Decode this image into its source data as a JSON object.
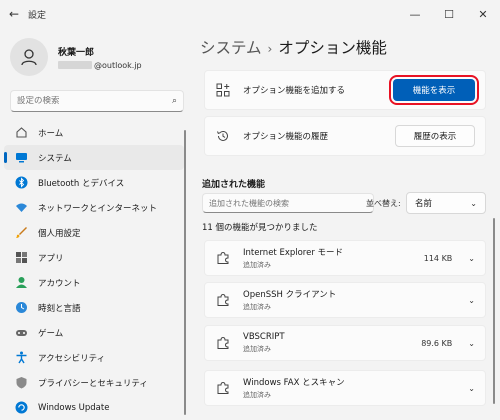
{
  "window": {
    "title": "設定"
  },
  "profile": {
    "name": "秋葉一郎",
    "email_suffix": "@outlook.jp"
  },
  "search": {
    "placeholder": "設定の検索"
  },
  "nav": [
    {
      "label": "ホーム",
      "icon": "home-icon"
    },
    {
      "label": "システム",
      "icon": "system-icon",
      "active": true
    },
    {
      "label": "Bluetooth とデバイス",
      "icon": "bluetooth-icon"
    },
    {
      "label": "ネットワークとインターネット",
      "icon": "network-icon"
    },
    {
      "label": "個人用設定",
      "icon": "brush-icon"
    },
    {
      "label": "アプリ",
      "icon": "apps-icon"
    },
    {
      "label": "アカウント",
      "icon": "account-icon"
    },
    {
      "label": "時刻と言語",
      "icon": "time-language-icon"
    },
    {
      "label": "ゲーム",
      "icon": "gaming-icon"
    },
    {
      "label": "アクセシビリティ",
      "icon": "accessibility-icon"
    },
    {
      "label": "プライバシーとセキュリティ",
      "icon": "shield-icon"
    },
    {
      "label": "Windows Update",
      "icon": "update-icon"
    }
  ],
  "main": {
    "breadcrumb_parent": "システム",
    "breadcrumb_sep": "›",
    "page_title": "オプション機能",
    "add_card": {
      "label": "オプション機能を追加する",
      "button": "機能を表示"
    },
    "history_card": {
      "label": "オプション機能の履歴",
      "button": "履歴の表示"
    },
    "installed_title": "追加された機能",
    "filter_placeholder": "追加された機能の検索",
    "sort_label": "並べ替え:",
    "sort_value": "名前",
    "count_text": "11 個の機能が見つかりました",
    "features": [
      {
        "name": "Internet Explorer モード",
        "status": "追加済み",
        "size": "114 KB"
      },
      {
        "name": "OpenSSH クライアント",
        "status": "追加済み",
        "size": ""
      },
      {
        "name": "VBSCRIPT",
        "status": "追加済み",
        "size": "89.6 KB"
      },
      {
        "name": "Windows FAX とスキャン",
        "status": "追加済み",
        "size": ""
      }
    ]
  },
  "colors": {
    "accent": "#0067c0",
    "primary_button": "#005fb8",
    "highlight": "#e81123"
  }
}
